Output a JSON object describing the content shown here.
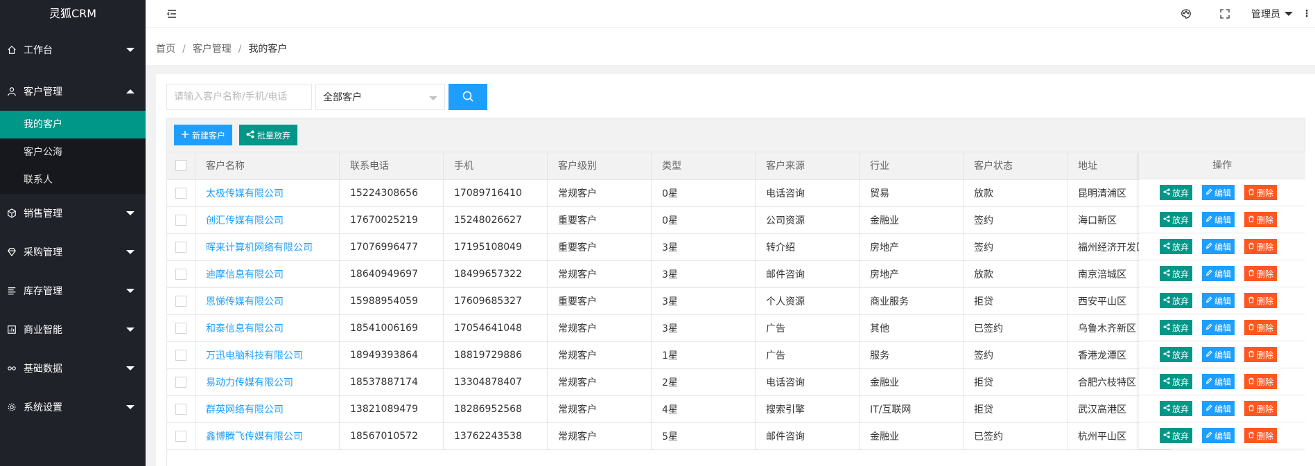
{
  "app": {
    "logo": "灵狐CRM"
  },
  "sidebar": {
    "items": [
      {
        "label": "工作台",
        "icon": "home-icon",
        "expanded": false
      },
      {
        "label": "客户管理",
        "icon": "user-icon",
        "expanded": true,
        "children": [
          {
            "label": "我的客户",
            "active": true
          },
          {
            "label": "客户公海",
            "active": false
          },
          {
            "label": "联系人",
            "active": false
          }
        ]
      },
      {
        "label": "销售管理",
        "icon": "box-icon",
        "expanded": false
      },
      {
        "label": "采购管理",
        "icon": "diamond-icon",
        "expanded": false
      },
      {
        "label": "库存管理",
        "icon": "list-icon",
        "expanded": false
      },
      {
        "label": "商业智能",
        "icon": "chart-icon",
        "expanded": false
      },
      {
        "label": "基础数据",
        "icon": "link-icon",
        "expanded": false
      },
      {
        "label": "系统设置",
        "icon": "gear-icon",
        "expanded": false
      }
    ]
  },
  "header": {
    "admin_label": "管理员",
    "more": "⋮"
  },
  "breadcrumb": {
    "home": "首页",
    "section": "客户管理",
    "current": "我的客户",
    "sep": "/"
  },
  "search": {
    "placeholder": "请输入客户名称/手机/电话",
    "filter_selected": "全部客户"
  },
  "toolbar": {
    "new_label": "新建客户",
    "batch_label": "批量放弃"
  },
  "table": {
    "columns": [
      "客户名称",
      "联系电话",
      "手机",
      "客户级别",
      "类型",
      "客户来源",
      "行业",
      "客户状态",
      "地址"
    ],
    "ops_header": "操作",
    "ops": {
      "abandon": "放弃",
      "edit": "编辑",
      "delete": "删除"
    },
    "rows": [
      [
        "太极传媒有限公司",
        "15224308656",
        "17089716410",
        "常规客户",
        "0星",
        "电话咨询",
        "贸易",
        "放款",
        "昆明清浦区"
      ],
      [
        "创汇传媒有限公司",
        "17670025219",
        "15248026627",
        "重要客户",
        "0星",
        "公司资源",
        "金融业",
        "签约",
        "海口新区"
      ],
      [
        "晖来计算机网络有限公司",
        "17076996477",
        "17195108049",
        "重要客户",
        "3星",
        "转介绍",
        "房地产",
        "签约",
        "福州经济开发区"
      ],
      [
        "迪摩信息有限公司",
        "18640949697",
        "18499657322",
        "常规客户",
        "3星",
        "邮件咨询",
        "房地产",
        "放款",
        "南京涪城区"
      ],
      [
        "恩悌传媒有限公司",
        "15988954059",
        "17609685327",
        "重要客户",
        "3星",
        "个人资源",
        "商业服务",
        "拒贷",
        "西安平山区"
      ],
      [
        "和泰信息有限公司",
        "18541006169",
        "17054641048",
        "常规客户",
        "3星",
        "广告",
        "其他",
        "已签约",
        "乌鲁木齐新区"
      ],
      [
        "万迅电脑科技有限公司",
        "18949393864",
        "18819729886",
        "常规客户",
        "1星",
        "广告",
        "服务",
        "签约",
        "香港龙潭区"
      ],
      [
        "易动力传媒有限公司",
        "18537887174",
        "13304878407",
        "常规客户",
        "2星",
        "电话咨询",
        "金融业",
        "拒贷",
        "合肥六枝特区"
      ],
      [
        "群英网络有限公司",
        "13821089479",
        "18286952568",
        "常规客户",
        "4星",
        "搜索引擎",
        "IT/互联网",
        "拒贷",
        "武汉高港区"
      ],
      [
        "鑫博腾飞传媒有限公司",
        "18567010572",
        "13762243538",
        "常规客户",
        "5星",
        "邮件咨询",
        "金融业",
        "已签约",
        "杭州平山区"
      ]
    ]
  },
  "colors": {
    "sidebar_bg": "#20222a",
    "active": "#009688",
    "primary": "#1e9fff",
    "danger": "#ff5722"
  }
}
